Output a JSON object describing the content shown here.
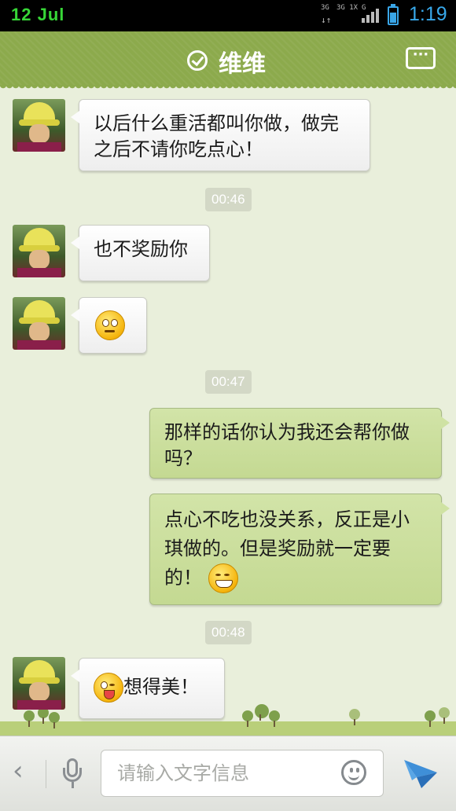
{
  "status_bar": {
    "date": "12 Jul",
    "net1": "3G",
    "net2": "3G 1X",
    "net3": "G",
    "time": "1:19",
    "battery_level": 0.75
  },
  "header": {
    "title": "维维",
    "more_label": "···"
  },
  "messages": {
    "m1": "以后什么重活都叫你做，做完之后不请你吃点心！",
    "t1": "00:46",
    "m2": "也不奖励你",
    "t2": "00:47",
    "m4": "那样的话你认为我还会帮你做吗？",
    "m5": "点心不吃也没关系，反正是小琪做的。但是奖励就一定要的！",
    "t3": "00:48",
    "m6": "想得美！"
  },
  "input": {
    "placeholder": "请输入文字信息",
    "back_label": "‹"
  },
  "colors": {
    "title_bar": "#8caa4c",
    "outgoing_bubble": "#c9dd98",
    "chat_bg": "#e9efdb",
    "time_accent": "#38a8ea"
  }
}
